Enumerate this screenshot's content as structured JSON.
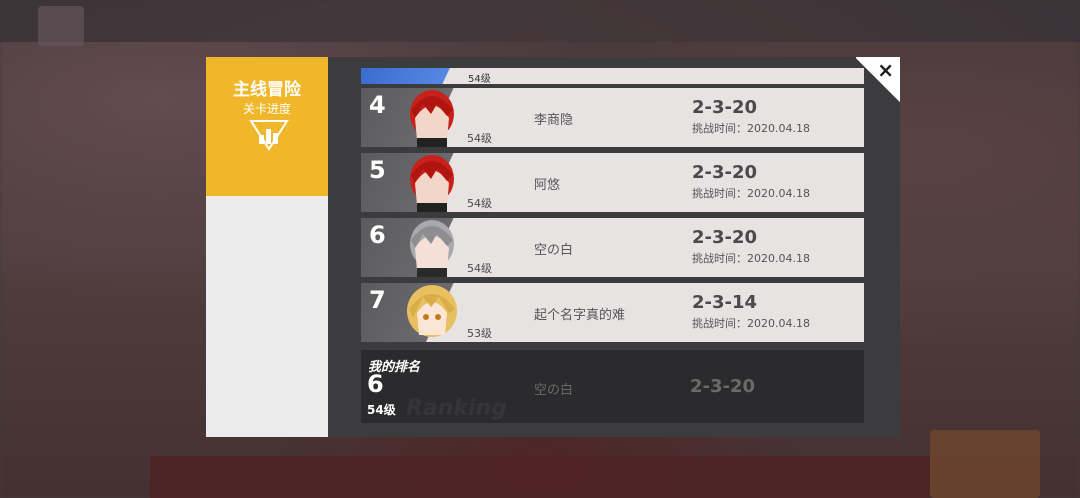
{
  "sidebar": {
    "title": "主线冒险",
    "subtitle": "关卡进度",
    "icon": "bar-chart-icon",
    "accent": "#f0b72a"
  },
  "ranking": {
    "partial_row": {
      "level": "54级"
    },
    "rows": [
      {
        "rank": "4",
        "name": "李商隐",
        "level": "54级",
        "stage": "2-3-20",
        "time": "挑战时间：2020.04.18",
        "hair": "#c8201a"
      },
      {
        "rank": "5",
        "name": "阿悠",
        "level": "54级",
        "stage": "2-3-20",
        "time": "挑战时间：2020.04.18",
        "hair": "#c8201a"
      },
      {
        "rank": "6",
        "name": "空の白",
        "level": "54级",
        "stage": "2-3-20",
        "time": "挑战时间：2020.04.18",
        "hair": "#9a9a9c"
      },
      {
        "rank": "7",
        "name": "起个名字真的难",
        "level": "53级",
        "stage": "2-3-14",
        "time": "挑战时间：2020.04.18",
        "hair": "#e8c060"
      }
    ]
  },
  "my_rank": {
    "label": "我的排名",
    "rank": "6",
    "level": "54级",
    "name": "空の白",
    "stage": "2-3-20",
    "watermark": "Ranking"
  },
  "close": {
    "label": "×",
    "icon": "close-icon"
  }
}
